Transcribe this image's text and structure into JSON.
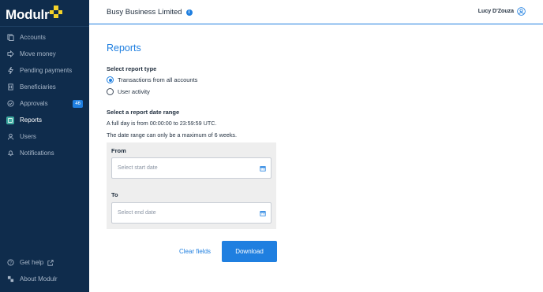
{
  "brand": {
    "name": "Modulr",
    "accent": "#f5d32a",
    "sidebar_bg": "#0f2c4c",
    "primary": "#1f7fe0"
  },
  "sidebar": {
    "items": [
      {
        "label": "Accounts",
        "icon": "accounts-icon"
      },
      {
        "label": "Move money",
        "icon": "arrow-right-icon"
      },
      {
        "label": "Pending payments",
        "icon": "lightning-icon"
      },
      {
        "label": "Beneficiaries",
        "icon": "building-icon"
      },
      {
        "label": "Approvals",
        "icon": "check-circle-icon",
        "badge": "46"
      },
      {
        "label": "Reports",
        "icon": "reports-icon",
        "active": true
      },
      {
        "label": "Users",
        "icon": "user-icon"
      },
      {
        "label": "Notifications",
        "icon": "bell-icon"
      }
    ],
    "bottom": [
      {
        "label": "Get help",
        "icon": "help-icon"
      },
      {
        "label": "About Modulr",
        "icon": "about-icon"
      }
    ]
  },
  "header": {
    "company": "Busy Business Limited",
    "user": "Lucy D'Zouza"
  },
  "main": {
    "title": "Reports",
    "report_type_label": "Select report type",
    "report_types": [
      {
        "label": "Transactions from all accounts",
        "checked": true
      },
      {
        "label": "User activity",
        "checked": false
      }
    ],
    "date_range_label": "Select a report date range",
    "date_info_1": "A full day is from 00:00:00 to 23:59:59 UTC.",
    "date_info_2": "The date range can only be a maximum of 6 weeks.",
    "from_label": "From",
    "from_placeholder": "Select start date",
    "to_label": "To",
    "to_placeholder": "Select end date",
    "clear_label": "Clear fields",
    "download_label": "Download"
  }
}
